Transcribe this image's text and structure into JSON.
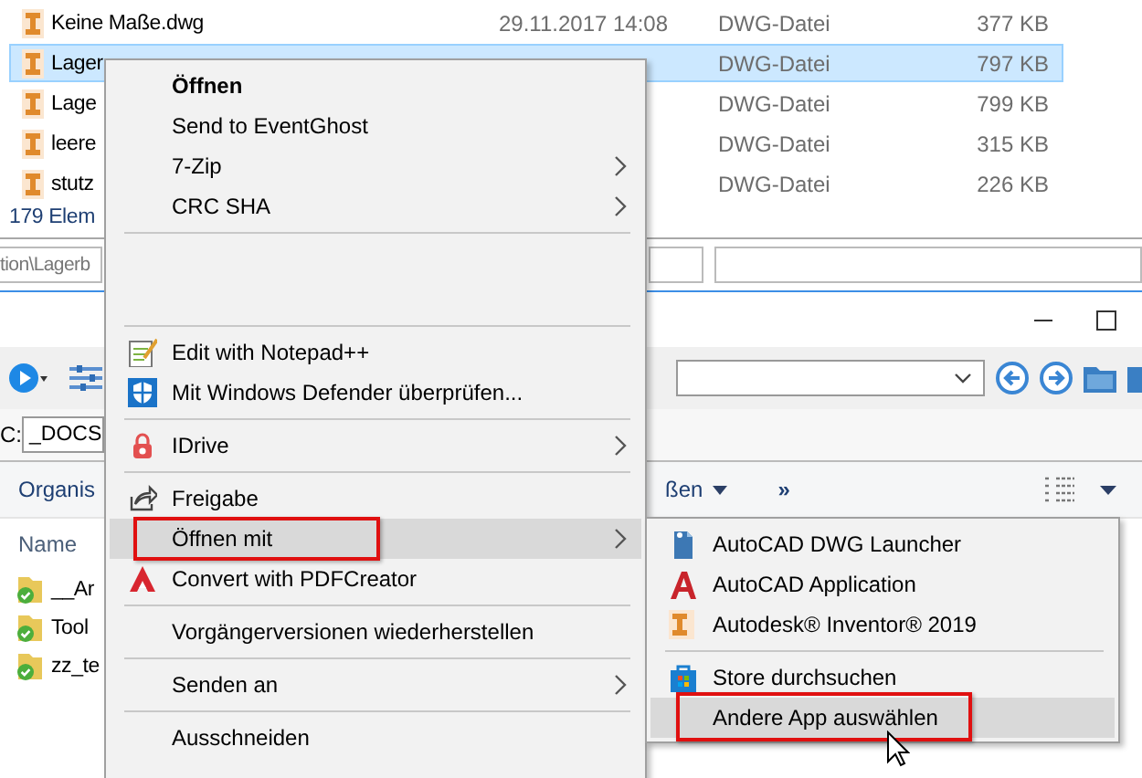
{
  "file_list": {
    "rows": [
      {
        "name": "Keine Maße.dwg",
        "date": "29.11.2017 14:08",
        "type": "DWG-Datei",
        "size": "377 KB",
        "selected": false
      },
      {
        "name": "Lager",
        "type": "DWG-Datei",
        "size": "797 KB",
        "selected": true
      },
      {
        "name": "Lage",
        "type": "DWG-Datei",
        "size": "799 KB",
        "selected": false
      },
      {
        "name": "leere",
        "type": "DWG-Datei",
        "size": "315 KB",
        "selected": false
      },
      {
        "name": "stutz",
        "type": "DWG-Datei",
        "size": "226 KB",
        "selected": false
      }
    ]
  },
  "status_bar": {
    "text": "179 Elem"
  },
  "path_field": {
    "value": "tion\\Lagerb"
  },
  "explorer_window": {
    "address": {
      "drive": "C:",
      "folder": "_DOCS"
    },
    "command_bar": {
      "first": "Organis",
      "second": "ßen",
      "overflow": "»"
    },
    "column_header": "Name",
    "folders": [
      "__Ar",
      "Tool",
      "zz_te"
    ]
  },
  "context_menu": {
    "items": [
      {
        "kind": "item",
        "label": "Öffnen",
        "bold": true,
        "submenu": false,
        "selected": false,
        "marked": false
      },
      {
        "kind": "item",
        "label": "Send to EventGhost",
        "bold": false,
        "submenu": false,
        "selected": false,
        "marked": false
      },
      {
        "kind": "item",
        "label": "7-Zip",
        "bold": false,
        "submenu": true,
        "selected": false,
        "marked": false
      },
      {
        "kind": "item",
        "label": "CRC SHA",
        "bold": false,
        "submenu": true,
        "selected": false,
        "marked": false
      },
      {
        "kind": "separator"
      },
      {
        "kind": "blank"
      },
      {
        "kind": "separator"
      },
      {
        "kind": "item",
        "label": "Edit with Notepad++",
        "bold": false,
        "submenu": false,
        "selected": false,
        "marked": false
      },
      {
        "kind": "item",
        "label": "Mit Windows Defender überprüfen...",
        "bold": false,
        "submenu": false,
        "selected": false,
        "marked": false
      },
      {
        "kind": "separator"
      },
      {
        "kind": "item",
        "label": "IDrive",
        "bold": false,
        "submenu": true,
        "selected": false,
        "marked": false
      },
      {
        "kind": "separator"
      },
      {
        "kind": "item",
        "label": "Freigabe",
        "bold": false,
        "submenu": false,
        "selected": false,
        "marked": false
      },
      {
        "kind": "item",
        "label": "Öffnen mit",
        "bold": false,
        "submenu": true,
        "selected": true,
        "marked": true
      },
      {
        "kind": "item",
        "label": "Convert with PDFCreator",
        "bold": false,
        "submenu": false,
        "selected": false,
        "marked": false
      },
      {
        "kind": "separator"
      },
      {
        "kind": "item",
        "label": "Vorgängerversionen wiederherstellen",
        "bold": false,
        "submenu": false,
        "selected": false,
        "marked": false
      },
      {
        "kind": "separator"
      },
      {
        "kind": "item",
        "label": "Senden an",
        "bold": false,
        "submenu": true,
        "selected": false,
        "marked": false
      },
      {
        "kind": "separator"
      },
      {
        "kind": "item",
        "label": "Ausschneiden",
        "bold": false,
        "submenu": false,
        "selected": false,
        "marked": false
      }
    ]
  },
  "open_with_submenu": {
    "items": [
      {
        "kind": "item",
        "label": "AutoCAD DWG Launcher",
        "selected": false,
        "marked": false
      },
      {
        "kind": "item",
        "label": "AutoCAD Application",
        "selected": false,
        "marked": false
      },
      {
        "kind": "item",
        "label": "Autodesk® Inventor® 2019",
        "selected": false,
        "marked": false
      },
      {
        "kind": "separator"
      },
      {
        "kind": "item",
        "label": "Store durchsuchen",
        "selected": false,
        "marked": false
      },
      {
        "kind": "item",
        "label": "Andere App auswählen",
        "selected": true,
        "marked": true
      }
    ]
  }
}
